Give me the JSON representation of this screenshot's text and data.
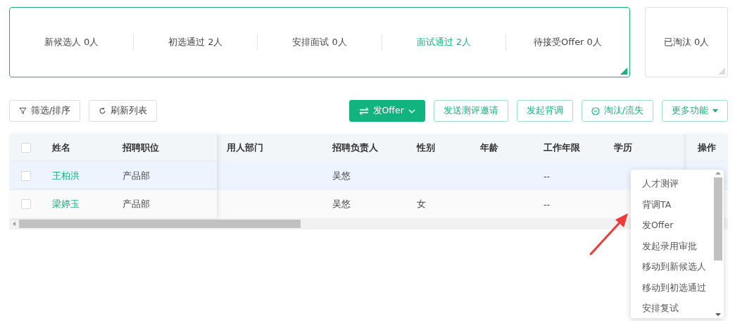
{
  "stages": {
    "active": true,
    "items": [
      {
        "label": "新候选人 0人",
        "selected": false
      },
      {
        "label": "初选通过 2人",
        "selected": false
      },
      {
        "label": "安排面试 0人",
        "selected": false
      },
      {
        "label": "面试通过 2人",
        "selected": true
      },
      {
        "label": "待接受Offer 0人",
        "selected": false
      }
    ]
  },
  "eliminated": {
    "label": "已淘汰 0人",
    "active": false
  },
  "toolbar": {
    "left": [
      {
        "label": "筛选/排序",
        "kind": "filter"
      },
      {
        "label": "刷新列表",
        "kind": "refresh"
      }
    ],
    "right": [
      {
        "label": "发Offer",
        "kind": "primary"
      },
      {
        "label": "发送测评邀请",
        "kind": "outline"
      },
      {
        "label": "发起背调",
        "kind": "outline"
      },
      {
        "label": "淘汰/流失",
        "kind": "reject"
      },
      {
        "label": "更多功能",
        "kind": "more"
      }
    ]
  },
  "table": {
    "all_checked": false,
    "columns": [
      "姓名",
      "招聘职位",
      "用人部门",
      "招聘负责人",
      "性别",
      "年龄",
      "工作年限",
      "学历",
      "操作"
    ],
    "rows": [
      {
        "checked": false,
        "highlighted": true,
        "cells": [
          "王柏洪",
          "产品部",
          "",
          "吴悠",
          "",
          "",
          "--",
          "",
          ""
        ]
      },
      {
        "checked": false,
        "highlighted": false,
        "cells": [
          "梁婷玉",
          "产品部",
          "",
          "吴悠",
          "女",
          "",
          "--",
          "",
          ""
        ]
      }
    ]
  },
  "menu": {
    "items": [
      "人才测评",
      "背调TA",
      "发Offer",
      "发起录用审批",
      "移动到新候选人",
      "移动到初选通过",
      "安排复试"
    ]
  }
}
